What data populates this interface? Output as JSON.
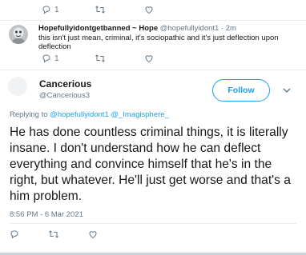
{
  "top_actions": {
    "reply_count": "1",
    "retweet_count": "",
    "like_count": ""
  },
  "reply_tweet": {
    "name": "Hopefullyidontgetbanned ~ Hope",
    "handle": "@hopefullyidont1",
    "separator": "·",
    "time": "2m",
    "text": "this isn't just mean, criminal, it's sociopathic and it's just deflection upon deflection",
    "reply_count": "1",
    "retweet_count": "",
    "like_count": ""
  },
  "main_tweet": {
    "name": "Cancerious",
    "handle": "@Cancerious3",
    "follow_label": "Follow",
    "replying_prefix": "Replying to",
    "replying_to": "@hopefullyidont1 @_Imagisphere_",
    "text": "He has done countless criminal things, it is literally insane. I don't understand how he can deflect everything and convince himself that he's in the right, but whatever. He'll just get worse and that's a him problem.",
    "timestamp": "8:56 PM - 6 Mar 2021"
  },
  "icons": {
    "reply": "reply-icon",
    "retweet": "retweet-icon",
    "like": "heart-icon",
    "more": "chevron-down-icon"
  },
  "colors": {
    "accent": "#1da1f2",
    "muted": "#657786",
    "text": "#14171a",
    "divider": "#e6ecf0"
  }
}
